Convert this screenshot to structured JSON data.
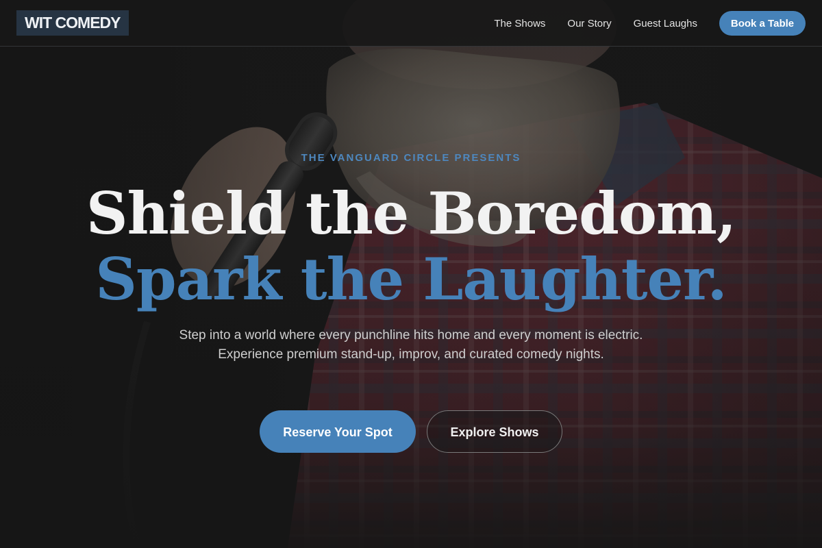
{
  "brand": {
    "logo_text": "WIT COMEDY"
  },
  "nav": {
    "links": [
      {
        "label": "The Shows"
      },
      {
        "label": "Our Story"
      },
      {
        "label": "Guest Laughs"
      }
    ],
    "cta_label": "Book a Table"
  },
  "hero": {
    "eyebrow": "THE VANGUARD CIRCLE PRESENTS",
    "headline_line1": "Shield the Boredom,",
    "headline_line2": "Spark the Laughter.",
    "subtext": "Step into a world where every punchline hits home and every moment is electric. Experience premium stand-up, improv, and curated comedy nights.",
    "primary_button": "Reserve Your Spot",
    "secondary_button": "Explore Shows",
    "background_image": "comedian-with-microphone-photo"
  },
  "colors": {
    "accent": "#4682b9",
    "background": "#171717",
    "logo_bg": "#263443",
    "headline_primary": "#f2f2f2"
  }
}
